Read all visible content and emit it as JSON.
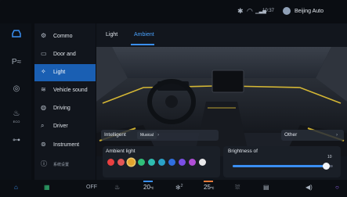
{
  "status_bar": {
    "time": "10:37",
    "location": "Beijing Auto",
    "icons": [
      "bluetooth-icon",
      "wifi-icon",
      "signal-icon",
      "avatar-icon"
    ]
  },
  "rail": {
    "items": [
      {
        "icon": "car-icon",
        "label": ""
      },
      {
        "icon": "parking-icon",
        "label": ""
      },
      {
        "icon": "steering-wheel-icon",
        "label": ""
      },
      {
        "icon": "eco-icon",
        "label": "ECO"
      },
      {
        "icon": "vehicle-side-icon",
        "label": ""
      }
    ],
    "active_index": 0
  },
  "menu": {
    "items": [
      {
        "icon": "gear-icon",
        "label": "Commo"
      },
      {
        "icon": "door-icon",
        "label": "Door       and"
      },
      {
        "icon": "light-icon",
        "label": "Light"
      },
      {
        "icon": "sound-icon",
        "label": "Vehicle sound"
      },
      {
        "icon": "driving-icon",
        "label": "Driving"
      },
      {
        "icon": "driver-icon",
        "label": "Driver"
      },
      {
        "icon": "instrument-icon",
        "label": "Instrument"
      },
      {
        "icon": "info-icon",
        "label": "系统设置"
      }
    ],
    "active_index": 2
  },
  "tabs": {
    "items": [
      "Light",
      "Ambient"
    ],
    "active_index": 1
  },
  "controls": {
    "intelligent_label": "Intelligent",
    "intelligent_value": "Musical",
    "other_label": "Other",
    "ambient_title": "Ambient   light",
    "ambient_colors": [
      "#e94040",
      "#e35757",
      "#e2a52f",
      "#30c07a",
      "#2ebdb0",
      "#2aa2c8",
      "#2f6fe0",
      "#7a4fe6",
      "#b04ed6",
      "#e8e8ea"
    ],
    "ambient_selected_index": 2,
    "brightness_title": "Brightness   of",
    "brightness_value": "10",
    "brightness_level": 0.93
  },
  "bottom_bar": {
    "off_label": "OFF",
    "temp_left": "20",
    "temp_left_unit": "℃",
    "fan_level": "2",
    "temp_right": "25",
    "temp_right_unit": "℃"
  },
  "colors": {
    "accent": "#3a8ff2",
    "active_menu": "#1a5fb3",
    "ambient_glow": "#e8c635",
    "eco": "#35c07a"
  }
}
